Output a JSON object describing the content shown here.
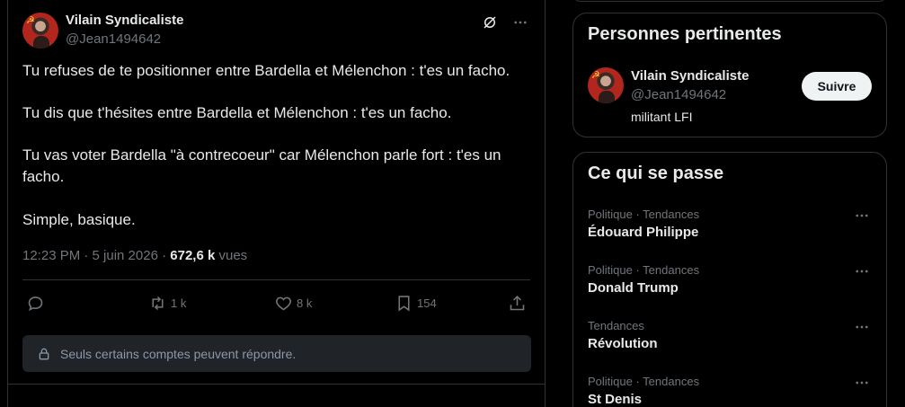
{
  "tweet": {
    "author_name": "Vilain Syndicaliste",
    "author_handle": "@Jean1494642",
    "paragraphs": [
      "Tu refuses de te positionner entre Bardella et Mélenchon : t'es un facho.",
      "Tu dis que t'hésites entre Bardella et Mélenchon : t'es un facho.",
      "Tu vas voter Bardella \"à contrecoeur\" car Mélenchon parle fort : t'es un facho.",
      "Simple, basique."
    ],
    "time": "12:23 PM · 5 juin 2026 · ",
    "views_count": "672,6 k",
    "views_label": " vues",
    "actions": {
      "reply_icon": "reply-icon",
      "retweet_count": "1 k",
      "like_count": "8 k",
      "bookmark_count": "154"
    },
    "reply_restriction": "Seuls certains comptes peuvent répondre."
  },
  "relevant_people": {
    "title": "Personnes pertinentes",
    "person": {
      "name": "Vilain Syndicaliste",
      "handle": "@Jean1494642",
      "bio": "militant LFI",
      "follow_label": "Suivre"
    }
  },
  "trends": {
    "title": "Ce qui se passe",
    "items": [
      {
        "category": "Politique · Tendances",
        "name": "Édouard Philippe"
      },
      {
        "category": "Politique · Tendances",
        "name": "Donald Trump"
      },
      {
        "category": "Tendances",
        "name": "Révolution"
      },
      {
        "category": "Politique · Tendances",
        "name": "St Denis"
      }
    ]
  },
  "colors": {
    "background": "#000000",
    "border": "#2f3336",
    "text_primary": "#e7e9ea",
    "text_secondary": "#71767b",
    "button_bg": "#eff3f4"
  }
}
